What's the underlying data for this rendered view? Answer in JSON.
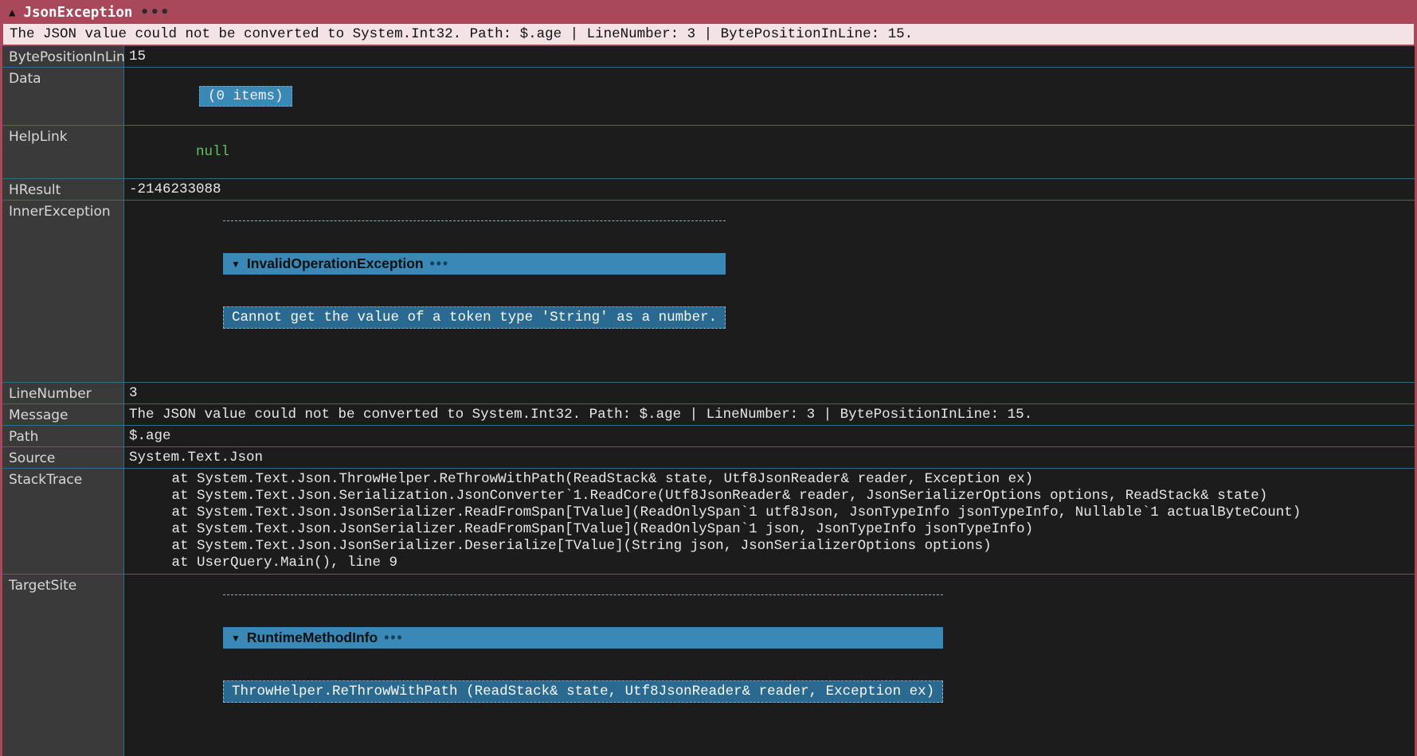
{
  "header": {
    "title": "JsonException"
  },
  "summary": "The JSON value could not be converted to System.Int32. Path: $.age | LineNumber: 3 | BytePositionInLine: 15.",
  "props": {
    "bytePositionInLine": {
      "label": "BytePositionInLine",
      "value": "15"
    },
    "data": {
      "label": "Data",
      "value": "(0 items)"
    },
    "helpLink": {
      "label": "HelpLink",
      "value": "null"
    },
    "hresult": {
      "label": "HResult",
      "value": "-2146233088"
    },
    "innerException": {
      "label": "InnerException",
      "title": "InvalidOperationException",
      "message": "Cannot get the value of a token type 'String' as a number."
    },
    "lineNumber": {
      "label": "LineNumber",
      "value": "3"
    },
    "message": {
      "label": "Message",
      "value": "The JSON value could not be converted to System.Int32. Path: $.age | LineNumber: 3 | BytePositionInLine: 15."
    },
    "path": {
      "label": "Path",
      "value": "$.age"
    },
    "source": {
      "label": "Source",
      "value": "System.Text.Json"
    },
    "stackTrace": {
      "label": "StackTrace",
      "value": "   at System.Text.Json.ThrowHelper.ReThrowWithPath(ReadStack& state, Utf8JsonReader& reader, Exception ex)\n   at System.Text.Json.Serialization.JsonConverter`1.ReadCore(Utf8JsonReader& reader, JsonSerializerOptions options, ReadStack& state)\n   at System.Text.Json.JsonSerializer.ReadFromSpan[TValue](ReadOnlySpan`1 utf8Json, JsonTypeInfo jsonTypeInfo, Nullable`1 actualByteCount)\n   at System.Text.Json.JsonSerializer.ReadFromSpan[TValue](ReadOnlySpan`1 json, JsonTypeInfo jsonTypeInfo)\n   at System.Text.Json.JsonSerializer.Deserialize[TValue](String json, JsonSerializerOptions options)\n   at UserQuery.Main(), line 9"
    },
    "targetSite": {
      "label": "TargetSite",
      "title": "RuntimeMethodInfo",
      "value": "ThrowHelper.ReThrowWithPath (ReadStack& state, Utf8JsonReader& reader, Exception ex)"
    }
  }
}
